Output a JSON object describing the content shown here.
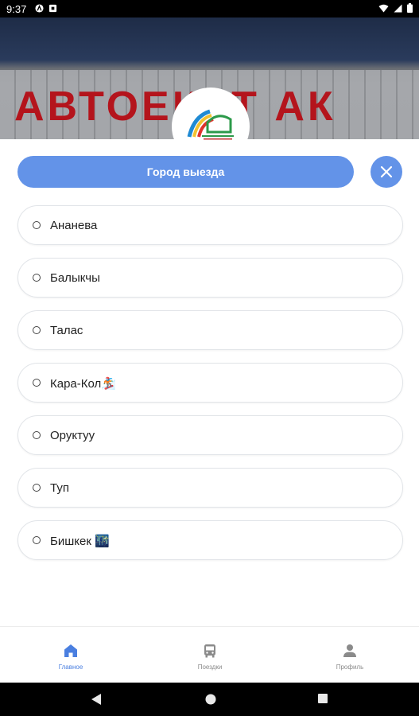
{
  "status_bar": {
    "time": "9:37"
  },
  "banner": {
    "sign_text": "АВТОЕКЕТ АК"
  },
  "header": {
    "title": "Город выезда"
  },
  "cities": [
    {
      "label": "Ананева"
    },
    {
      "label": "Балыкчы"
    },
    {
      "label": "Талас"
    },
    {
      "label": "Кара-Кол🏂"
    },
    {
      "label": "Оруктуу"
    },
    {
      "label": "Туп"
    },
    {
      "label": "Бишкек 🌃"
    }
  ],
  "tabs": [
    {
      "label": "Главное",
      "icon": "home-icon"
    },
    {
      "label": "Поездки",
      "icon": "bus-icon"
    },
    {
      "label": "Профиль",
      "icon": "person-icon"
    }
  ],
  "colors": {
    "accent": "#6393e8",
    "active_tab": "#4a7fe0"
  }
}
